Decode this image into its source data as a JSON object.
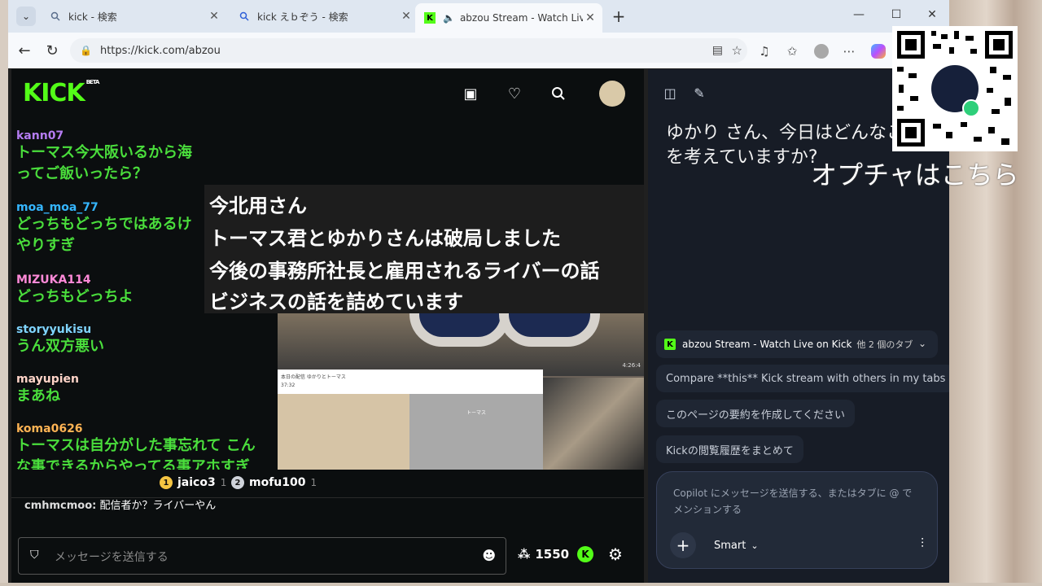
{
  "browser": {
    "tabs": [
      {
        "title": "kick - 検索",
        "active": false
      },
      {
        "title": "kick えｂぞう - 検索",
        "active": false
      },
      {
        "title": "abzou Stream - Watch Live on",
        "active": true
      }
    ],
    "url": "https://kick.com/abzou",
    "new_tab_glyph": "+",
    "window_controls": [
      "—",
      "☐",
      "✕"
    ]
  },
  "kick": {
    "logo": "KICK",
    "logo_badge": "BETA",
    "chat": [
      {
        "user": "kann07",
        "user_color": "#b57cf2",
        "lines": [
          "トーマス今大阪いるから海",
          "ってご飯いったら？"
        ]
      },
      {
        "user": "moa_moa_77",
        "user_color": "#35b6ff",
        "lines": [
          "どっちもどっちではあるけ",
          "やりすぎ"
        ]
      },
      {
        "user": "MIZUKA114",
        "user_color": "#ff8ad8",
        "lines": [
          "どっちもどっちよ"
        ]
      },
      {
        "user": "storyyukisu",
        "user_color": "#7fd4ff",
        "lines": [
          "うん双方悪い"
        ]
      },
      {
        "user": "mayupien",
        "user_color": "#ffd4c8",
        "lines": [
          "まあね"
        ]
      },
      {
        "user": "koma0626",
        "user_color": "#ffb454",
        "lines": [
          "トーマスは自分がした事忘れて こん",
          "な事できるからやってる事アホすぎ"
        ]
      }
    ],
    "overlay_lines": [
      "今北用さん",
      "トーマス君とゆかりさんは破局しました",
      "今後の事務所社長と雇用されるライバーの話",
      "ビジネスの話を詰めています"
    ],
    "video_time": "4:26:4",
    "pip_title": "本日の配信 ゆかりとトーマス",
    "pip_time": "37:32",
    "pip_label": "トーマス",
    "top_viewers": [
      {
        "rank": "1",
        "name": "jaico3",
        "count": "1",
        "badge_color": "#f5c542"
      },
      {
        "rank": "2",
        "name": "mofu100",
        "count": "1",
        "badge_color": "#cfd3da"
      }
    ],
    "last_message": {
      "user": "cmhmcmoo:",
      "text": " 配信者か？ライバーやん"
    },
    "input_placeholder": "メッセージを送信する",
    "points": "1550"
  },
  "copilot": {
    "greeting_line1": "ゆかり さん、今日はどんなこ",
    "greeting_line2": "を考えていますか?",
    "context_tab": "abzou Stream - Watch Live on Kick",
    "context_more": "他 2 個のタブ",
    "suggestions": [
      "Compare **this** Kick stream with others in my tabs",
      "このページの要約を作成してください",
      "Kickの閲覧履歴をまとめて"
    ],
    "composer_placeholder": "Copilot にメッセージを送信する、またはタブに @ でメンションする",
    "mode": "Smart"
  },
  "overlay_text": "オプチャはこちら"
}
